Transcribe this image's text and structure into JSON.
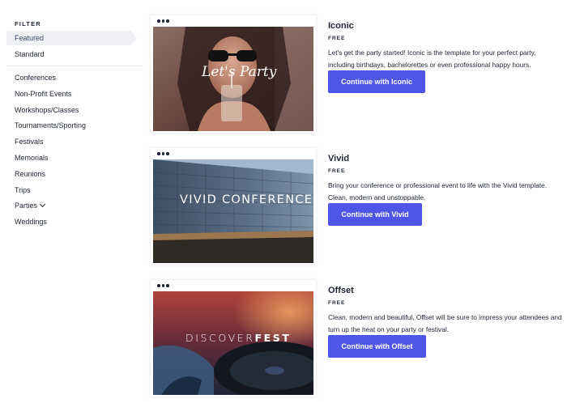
{
  "sidebar": {
    "filter_label": "FILTER",
    "featured": "Featured",
    "standard": "Standard",
    "categories": [
      "Conferences",
      "Non-Profit Events",
      "Workshops/Classes",
      "Tournaments/Sporting",
      "Festivals",
      "Memorials",
      "Reunions",
      "Trips",
      "Parties",
      "Weddings"
    ]
  },
  "templates": [
    {
      "title": "Iconic",
      "price": "FREE",
      "description": "Let's get the party started! Iconic is the template for your perfect party, including birthdays, bachelorettes or even professional happy hours.",
      "button": "Continue with Iconic",
      "thumb_text": "Let's Party"
    },
    {
      "title": "Vivid",
      "price": "FREE",
      "description": "Bring your conference or professional event to life with the Vivid template. Clean, modern and unstoppable.",
      "button": "Continue with Vivid",
      "thumb_text": "VIVID CONFERENCE"
    },
    {
      "title": "Offset",
      "price": "FREE",
      "description": "Clean, modern and beautiful, Offset will be sure to impress your attendees and turn up the heat on your party or festival.",
      "button": "Continue with Offset",
      "thumb_text_a": "DISCOVER",
      "thumb_text_b": "FEST"
    }
  ],
  "colors": {
    "accent": "#4f55e6",
    "active_bg": "#eef0f3",
    "text": "#1e2433"
  },
  "icons": [
    "more-dots-icon",
    "chevron-down-icon"
  ]
}
